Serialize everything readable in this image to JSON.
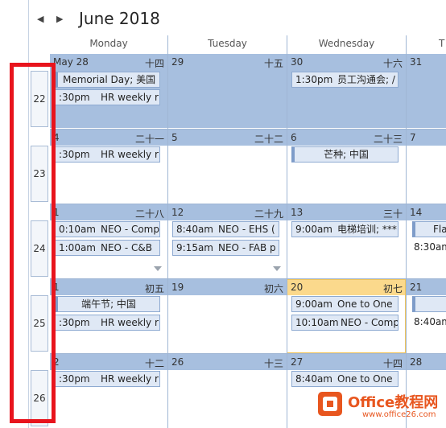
{
  "header": {
    "prev": "◀",
    "next": "▶",
    "title": "June 2018"
  },
  "weekdays": [
    "Monday",
    "Tuesday",
    "Wednesday",
    "T"
  ],
  "weeks": [
    "22",
    "23",
    "24",
    "25",
    "26"
  ],
  "days": {
    "r1": [
      {
        "d": "May 28",
        "l": "十四"
      },
      {
        "d": "29",
        "l": "十五"
      },
      {
        "d": "30",
        "l": "十六"
      },
      {
        "d": "31",
        "l": ""
      }
    ],
    "r2": [
      {
        "d": "4",
        "l": "二十一"
      },
      {
        "d": "5",
        "l": "二十二"
      },
      {
        "d": "6",
        "l": "二十三"
      },
      {
        "d": "7",
        "l": ""
      }
    ],
    "r3": [
      {
        "d": "1",
        "l": "二十八"
      },
      {
        "d": "12",
        "l": "二十九"
      },
      {
        "d": "13",
        "l": "三十"
      },
      {
        "d": "14",
        "l": ""
      }
    ],
    "r4": [
      {
        "d": "1",
        "l": "初五"
      },
      {
        "d": "19",
        "l": "初六"
      },
      {
        "d": "20",
        "l": "初七"
      },
      {
        "d": "21",
        "l": ""
      }
    ],
    "r5": [
      {
        "d": "2",
        "l": "十二"
      },
      {
        "d": "26",
        "l": "十三"
      },
      {
        "d": "27",
        "l": "十四"
      },
      {
        "d": "28",
        "l": ""
      }
    ]
  },
  "events": {
    "e_memorial": {
      "title": "Memorial Day; 美国"
    },
    "e_hr1": {
      "time": ":30pm",
      "title": "HR weekly r"
    },
    "e_staff": {
      "time": "1:30pm",
      "title": "员工沟通会; /"
    },
    "e_hr2": {
      "time": ":30pm",
      "title": "HR weekly r"
    },
    "e_mangzhong": {
      "title": "芒种; 中国"
    },
    "e_neo_comp": {
      "time": "0:10am",
      "title": "NEO - Comp"
    },
    "e_neo_cb": {
      "time": "1:00am",
      "title": "NEO - C&B"
    },
    "e_neo_ehs": {
      "time": "8:40am",
      "title": "NEO - EHS ("
    },
    "e_neo_fab": {
      "time": "9:15am",
      "title": "NEO - FAB p"
    },
    "e_elevator": {
      "time": "9:00am",
      "title": "电梯培训; ***"
    },
    "e_fla": {
      "title": "Fla"
    },
    "e_thu_830": {
      "time": "8:30am",
      "title": ""
    },
    "e_duanwu": {
      "title": "端午节; 中国"
    },
    "e_hr3": {
      "time": ":30pm",
      "title": "HR weekly r"
    },
    "e_one1": {
      "time": "9:00am",
      "title": "One to One"
    },
    "e_neo_comp2": {
      "time": "10:10am",
      "title": "NEO - Comp"
    },
    "e_thu_840": {
      "time": "8:40am",
      "title": ""
    },
    "e_hr4": {
      "time": ":30pm",
      "title": "HR weekly r"
    },
    "e_one2": {
      "time": "8:40am",
      "title": "One to One"
    }
  },
  "watermark": {
    "brand": "Office教程网",
    "url": "www.office26.com"
  },
  "colors": {
    "highlight": "#e8141d",
    "selected_day": "#fbd98c",
    "week_shade": "#a7bfdf"
  }
}
